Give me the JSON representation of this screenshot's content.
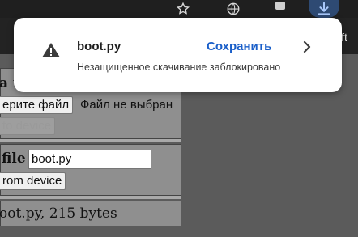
{
  "popup": {
    "filename": "boot.py",
    "save_label": "Сохранить",
    "status": "Незащищенное скачивание заблокировано"
  },
  "chrome": {
    "partial_tab_text": "ift"
  },
  "upload_panel": {
    "title_partial": "a f",
    "choose_button": "ерите файл",
    "no_file_text": "Файл не выбран",
    "upload_button": "to device"
  },
  "download_panel": {
    "label": "file",
    "filename_value": "boot.py",
    "download_button": "rom device"
  },
  "status_panel": {
    "text": "oot.py, 215 bytes"
  },
  "colors": {
    "accent": "#1a5fc9",
    "download_button_bg": "#2e4a73",
    "panel_bg": "#8f8f8f",
    "page_bg": "#5b5b5b"
  }
}
